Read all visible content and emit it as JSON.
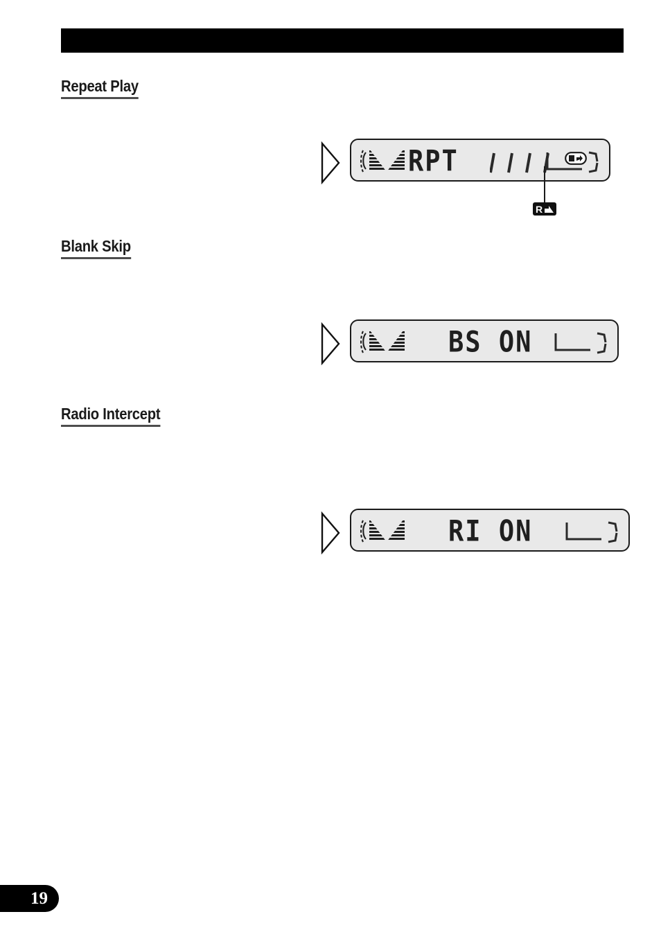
{
  "page": {
    "number": "19",
    "header_bar_color": "#000000",
    "background_color": "#ffffff"
  },
  "sections": [
    {
      "id": "repeat-play",
      "heading": "Repeat Play",
      "display": {
        "eq_icon": "lcd-level-meter-icon",
        "arrow_icon": "triangle-right-outline-icon",
        "text": "RPT",
        "unlit_segments": 4,
        "indicator": {
          "icon": "circled-repeat-indicator-icon",
          "letter": "R"
        },
        "bracket_glyph": "unlit-bracket-segments-icon",
        "callout": {
          "icon": "repeat-badge-icon",
          "letter": "R"
        }
      }
    },
    {
      "id": "blank-skip",
      "heading": "Blank Skip",
      "display": {
        "eq_icon": "lcd-level-meter-icon",
        "arrow_icon": "triangle-right-outline-icon",
        "text": "BS ON",
        "bracket_glyph": "unlit-bracket-segments-icon"
      }
    },
    {
      "id": "radio-intercept",
      "heading": "Radio Intercept",
      "display": {
        "eq_icon": "lcd-level-meter-icon",
        "arrow_icon": "triangle-right-outline-icon",
        "text": "RI ON",
        "bracket_glyph": "unlit-bracket-segments-icon"
      }
    }
  ]
}
